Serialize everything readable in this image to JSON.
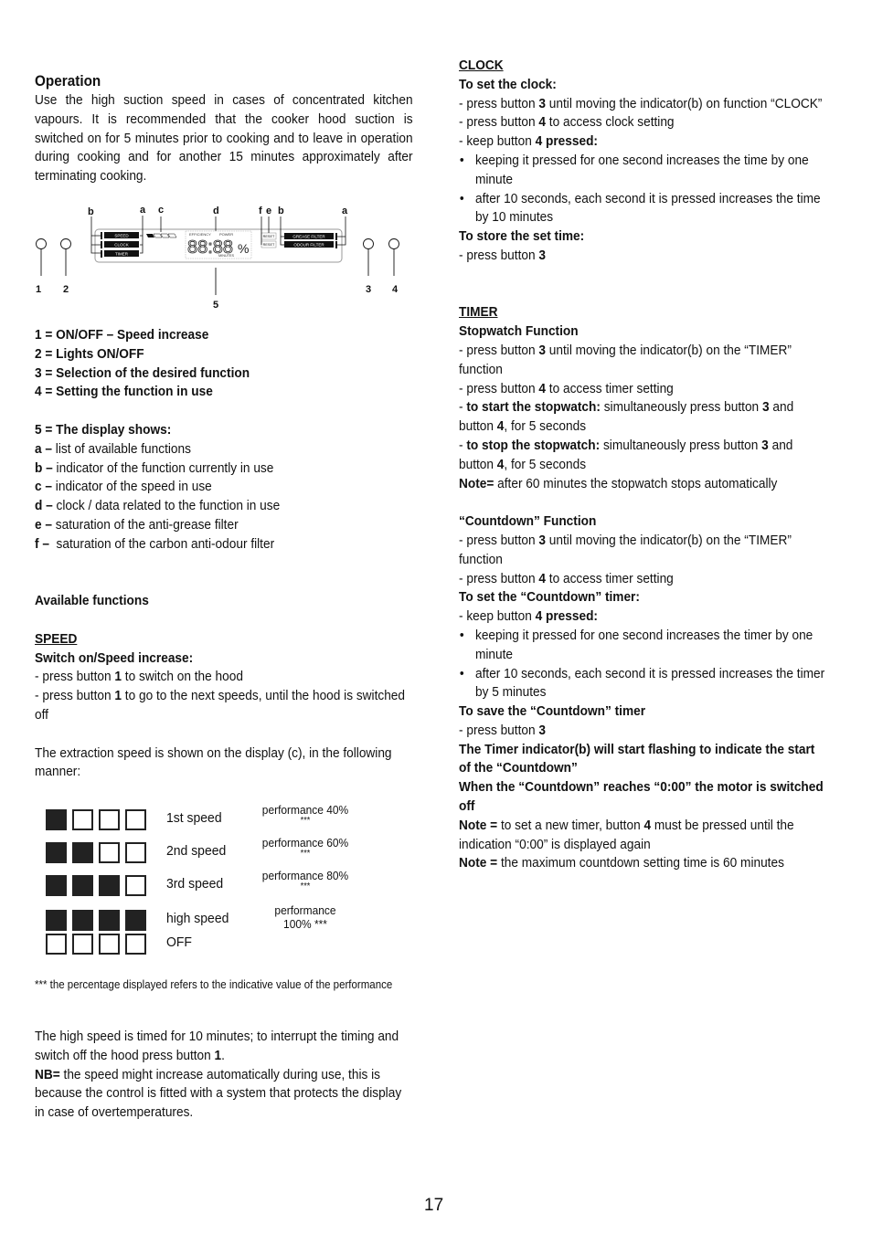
{
  "operation": {
    "heading": "Operation",
    "paragraph": "Use the high suction speed in cases of concentrated kitchen vapours.  It is recommended that the cooker hood suction is switched on for 5 minutes prior to cooking and to leave in operation during cooking and for another 15 minutes approximately after terminating cooking."
  },
  "diagram": {
    "callouts": {
      "b_left": "b",
      "a_left": "a",
      "c": "c",
      "d": "d",
      "f": "f",
      "e": "e",
      "b_right": "b",
      "a_right": "a"
    },
    "buttons": [
      "1",
      "2",
      "3",
      "4"
    ],
    "display_label": "5",
    "function_labels_left": [
      "SPEED",
      "CLOCK",
      "TIMER"
    ],
    "function_labels_right": [
      "GREASE FILTER",
      "ODOUR FILTER"
    ],
    "reset_labels": [
      "RESET",
      "RESET"
    ],
    "display_top_labels": [
      "EFFICIENCY",
      "POWER"
    ],
    "display_digits": "88:88",
    "display_percent": "%",
    "display_bottom_label": "MINUTES"
  },
  "legend": {
    "buttons": [
      "1 = ON/OFF – Speed increase",
      "2 = Lights ON/OFF",
      "3 = Selection of the desired function",
      "4 = Setting the function in use"
    ],
    "display_heading": "5 = The display shows:",
    "display_items": [
      {
        "key": "a –",
        "text": " list of available functions"
      },
      {
        "key": "b –",
        "text": " indicator of the function currently in use"
      },
      {
        "key": "c –",
        "text": " indicator of the speed in use"
      },
      {
        "key": "d –",
        "text": " clock / data related to the function in use"
      },
      {
        "key": "e –",
        "text": " saturation of the anti-grease filter"
      },
      {
        "key": "f –",
        "text": "  saturation of the carbon anti-odour filter"
      }
    ]
  },
  "available": {
    "heading": "Available functions",
    "speed_title": "SPEED",
    "switch_on_heading": "Switch on/Speed increase:",
    "line1": {
      "pre": "- press button ",
      "btn": "1",
      "post": " to switch on the hood"
    },
    "line2": {
      "pre": "- press button ",
      "btn": "1",
      "post": " to go to the next speeds, until the hood is switched off"
    },
    "extraction_text": "The extraction speed is shown on the display (c), in the following manner:"
  },
  "speed_table": [
    {
      "label": "1st speed",
      "filled": 1,
      "performance": "performance 40%",
      "stars": "***"
    },
    {
      "label": "2nd speed",
      "filled": 2,
      "performance": "performance 60%",
      "stars": "***"
    },
    {
      "label": "3rd speed",
      "filled": 3,
      "performance": "performance 80%",
      "stars": "***"
    },
    {
      "label": "high speed",
      "filled": 4,
      "performance": "performance",
      "stars": "100%  ***"
    },
    {
      "label": "OFF",
      "filled": 0,
      "performance": "",
      "stars": ""
    }
  ],
  "footnote": "*** the percentage displayed refers to the indicative value of the performance",
  "high_speed": {
    "pre": "The high speed is timed for 10 minutes; to interrupt the timing and switch off the hood press button ",
    "btn": "1",
    "post": "."
  },
  "nb": {
    "key": "NB=",
    "text": " the speed might increase automatically during use, this is because the control is fitted with a system that protects the display in case of overtemperatures."
  },
  "clock": {
    "title": "CLOCK",
    "set_heading": "To set the clock:",
    "l1": {
      "pre": "- press button ",
      "btn": "3",
      "post": " until moving the indicator(b) on function “CLOCK”"
    },
    "l2": {
      "pre": "- press button ",
      "btn": "4",
      "post": " to access clock setting"
    },
    "l3": {
      "pre": "- keep button ",
      "btn": "4 pressed:"
    },
    "bullets": [
      "keeping it pressed for one second increases the time by one minute",
      "after 10 seconds, each second it is pressed increases the time by 10 minutes"
    ],
    "store_heading": "To store the set time:",
    "l4": {
      "pre": "- press button ",
      "btn": "3"
    }
  },
  "timer": {
    "title": "TIMER",
    "stopwatch_heading": "Stopwatch Function",
    "s1": {
      "pre": "- press button ",
      "btn": "3",
      "post": " until moving the indicator(b) on the “TIMER” function"
    },
    "s2": {
      "pre": "- press button ",
      "btn": "4",
      "post": " to access timer setting"
    },
    "s3": {
      "dash": "- ",
      "bold": "to start the stopwatch:",
      "mid": " simultaneously press button ",
      "b1": "3",
      "and": " and button ",
      "b2": "4",
      "post": ", for 5 seconds"
    },
    "s4": {
      "dash": "- ",
      "bold": "to stop the stopwatch:",
      "mid": " simultaneously press button ",
      "b1": "3",
      "and": " and button ",
      "b2": "4",
      "post": ", for 5 seconds"
    },
    "s_note": {
      "key": "Note=",
      "text": " after 60 minutes the stopwatch stops automatically"
    },
    "countdown_heading": "“Countdown” Function",
    "c1": {
      "pre": "- press button ",
      "btn": "3",
      "post": " until moving the indicator(b) on the “TIMER” function"
    },
    "c2": {
      "pre": "- press button ",
      "btn": "4",
      "post": " to access timer setting"
    },
    "c_set_heading": "To set the “Countdown” timer:",
    "c3": {
      "pre": "- keep button ",
      "btn": "4 pressed:"
    },
    "c_bullets": [
      "keeping it pressed for one second increases the timer by one minute",
      "after 10 seconds, each second it is pressed increases the timer by 5 minutes"
    ],
    "c_save_heading": "To save the “Countdown” timer",
    "c4": {
      "pre": "- press button ",
      "btn": "3"
    },
    "c_flash": "The Timer indicator(b) will start flashing to indicate the start of the “Countdown”",
    "c_reach": "When the “Countdown” reaches “0:00” the motor is switched off",
    "note1": {
      "key": "Note =",
      "pre": " to set a new timer, button ",
      "btn": "4",
      "post": " must be pressed until the indication “0:00” is displayed again"
    },
    "note2": {
      "key": "Note =",
      "text": " the maximum countdown setting time is 60 minutes"
    }
  },
  "page_number": "17"
}
